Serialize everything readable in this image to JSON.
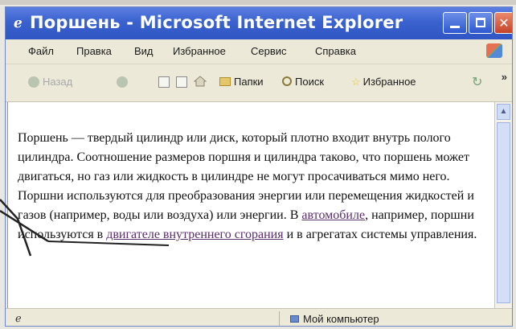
{
  "window": {
    "title": "Поршень - Microsoft Internet Explorer"
  },
  "menu": [
    {
      "label": "Файл"
    },
    {
      "label": "Правка"
    },
    {
      "label": "Вид"
    },
    {
      "label": "Избранное"
    },
    {
      "label": "Сервис"
    },
    {
      "label": "Справка"
    }
  ],
  "toolbar": {
    "back_label": "Назад",
    "folders_label": "Папки",
    "search_label": "Поиск",
    "favorites_label": "Избранное"
  },
  "content": {
    "text_before": "Поршень — твердый цилиндр или диск, который плотно входит внутрь полого цилиндра. Соотношение размеров поршня и цилиндра таково, что поршень может двигаться, но газ или жидкость в цилиндре не могут просачиваться мимо него. Поршни используются для преобразования энергии или перемещения жидкостей и газов (например, воды или воздуха) или энергии. В ",
    "link1": "автомобиле",
    "text_middle": ", например, поршни используются в ",
    "link2": "двигателе внутреннего сгорания",
    "text_after": " и в агрегатах системы управления."
  },
  "status": {
    "zone_label": "Мой компьютер"
  },
  "colors": {
    "titlebar": "#3a62cf",
    "link": "#5a2f6a"
  }
}
